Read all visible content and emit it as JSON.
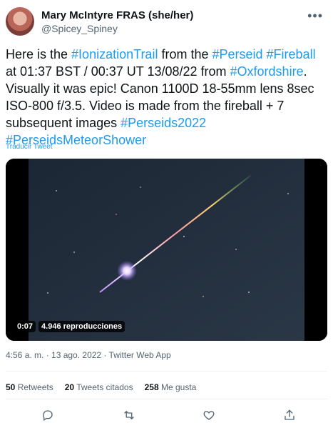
{
  "author": {
    "name": "Mary McIntyre FRAS (she/her)",
    "handle": "@Spicey_Spiney"
  },
  "tweet": {
    "text_segments": [
      {
        "t": "Here is the ",
        "tag": false
      },
      {
        "t": "#IonizationTrail",
        "tag": true
      },
      {
        "t": " from the ",
        "tag": false
      },
      {
        "t": "#Perseid",
        "tag": true
      },
      {
        "t": " ",
        "tag": false
      },
      {
        "t": "#Fireball",
        "tag": true
      },
      {
        "t": " at 01:37 BST / 00:37 UT 13/08/22 from ",
        "tag": false
      },
      {
        "t": "#Oxfordshire",
        "tag": true
      },
      {
        "t": ". Visually it was epic! Canon 1100D 18-55mm lens 8sec ISO-800 f/3.5. Video is made from the fireball + 7 subsequent images ",
        "tag": false
      },
      {
        "t": "#Perseids2022",
        "tag": true
      },
      {
        "t": " ",
        "tag": false
      },
      {
        "t": "#PerseidsMeteorShower",
        "tag": true
      }
    ],
    "translate_label": "Traducir Tweet"
  },
  "video": {
    "time": "0:07",
    "views": "4.946 reproducciones"
  },
  "meta": {
    "timestamp": "4:56 a. m. · 13 ago. 2022 · Twitter Web App"
  },
  "stats": {
    "retweets": {
      "count": "50",
      "label": "Retweets"
    },
    "quotes": {
      "count": "20",
      "label": "Tweets citados"
    },
    "likes": {
      "count": "258",
      "label": "Me gusta"
    }
  },
  "colors": {
    "link": "#1d9bf0",
    "muted": "#536471"
  }
}
